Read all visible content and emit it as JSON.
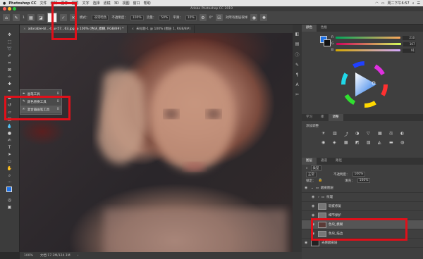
{
  "menubar": {
    "apple": "",
    "app": "Photoshop CC",
    "items": [
      "文件",
      "编辑",
      "图像",
      "图层",
      "文字",
      "选择",
      "滤镜",
      "3D",
      "视图",
      "窗口",
      "帮助"
    ],
    "clock": "周二下午6:57"
  },
  "window": {
    "title": "Adobe Photoshop CC 2019"
  },
  "options": {
    "size": "1",
    "mode_label": "模式：",
    "mode": "非常暗色",
    "opacity_label": "不透明度：",
    "opacity": "100%",
    "flow_label": "流量：",
    "flow": "50%",
    "smooth_label": "平滑：",
    "smooth": "10%",
    "angle": "0°",
    "sample_label": "对所有图层取样"
  },
  "tabs": [
    {
      "label": "adorable-bl...-blur-57...63.jpg @ 100% (色块_模糊, RGB/8#) *",
      "active": true
    },
    {
      "label": "未标题-1 @ 100% (图层 1, RGB/8#)",
      "active": false
    }
  ],
  "popup": {
    "items": [
      {
        "label": "画笔工具",
        "key": "B",
        "selected": false
      },
      {
        "label": "颜色替换工具",
        "key": "B",
        "selected": false
      },
      {
        "label": "混合器画笔工具",
        "key": "B",
        "selected": true
      }
    ]
  },
  "status": {
    "zoom": "100%",
    "doc": "文档:17.2M/124.1M"
  },
  "color_panel": {
    "tabs": [
      "颜色",
      "色板"
    ],
    "channels": [
      {
        "label": "R",
        "value": "210"
      },
      {
        "label": "G",
        "value": "167"
      },
      {
        "label": "B",
        "value": "91"
      }
    ],
    "swatch": "#d2a75b"
  },
  "adjust_panel": {
    "tabs": [
      "学习",
      "库",
      "调整"
    ],
    "title": "添加调整"
  },
  "layers_panel": {
    "tabs": [
      "图层",
      "通道",
      "路径"
    ],
    "filter": "类型",
    "blend": "正常",
    "opacity_label": "不透明度：",
    "opacity": "100%",
    "lock_label": "锁定：",
    "fill_label": "填充：",
    "fill": "100%",
    "layers": [
      {
        "name": "磨皮图层",
        "type": "group"
      },
      {
        "name": "纹理",
        "type": "group"
      },
      {
        "name": "瑕疵修复",
        "type": "layer"
      },
      {
        "name": "细节保护",
        "type": "layer"
      },
      {
        "name": "色块_模糊",
        "type": "layer",
        "selected": true
      },
      {
        "name": "色块_描边",
        "type": "layer"
      },
      {
        "name": "光感磨皮层",
        "type": "layer"
      }
    ]
  },
  "colors": {
    "accent": "#1f73e8",
    "highlight": "#e0101a"
  }
}
